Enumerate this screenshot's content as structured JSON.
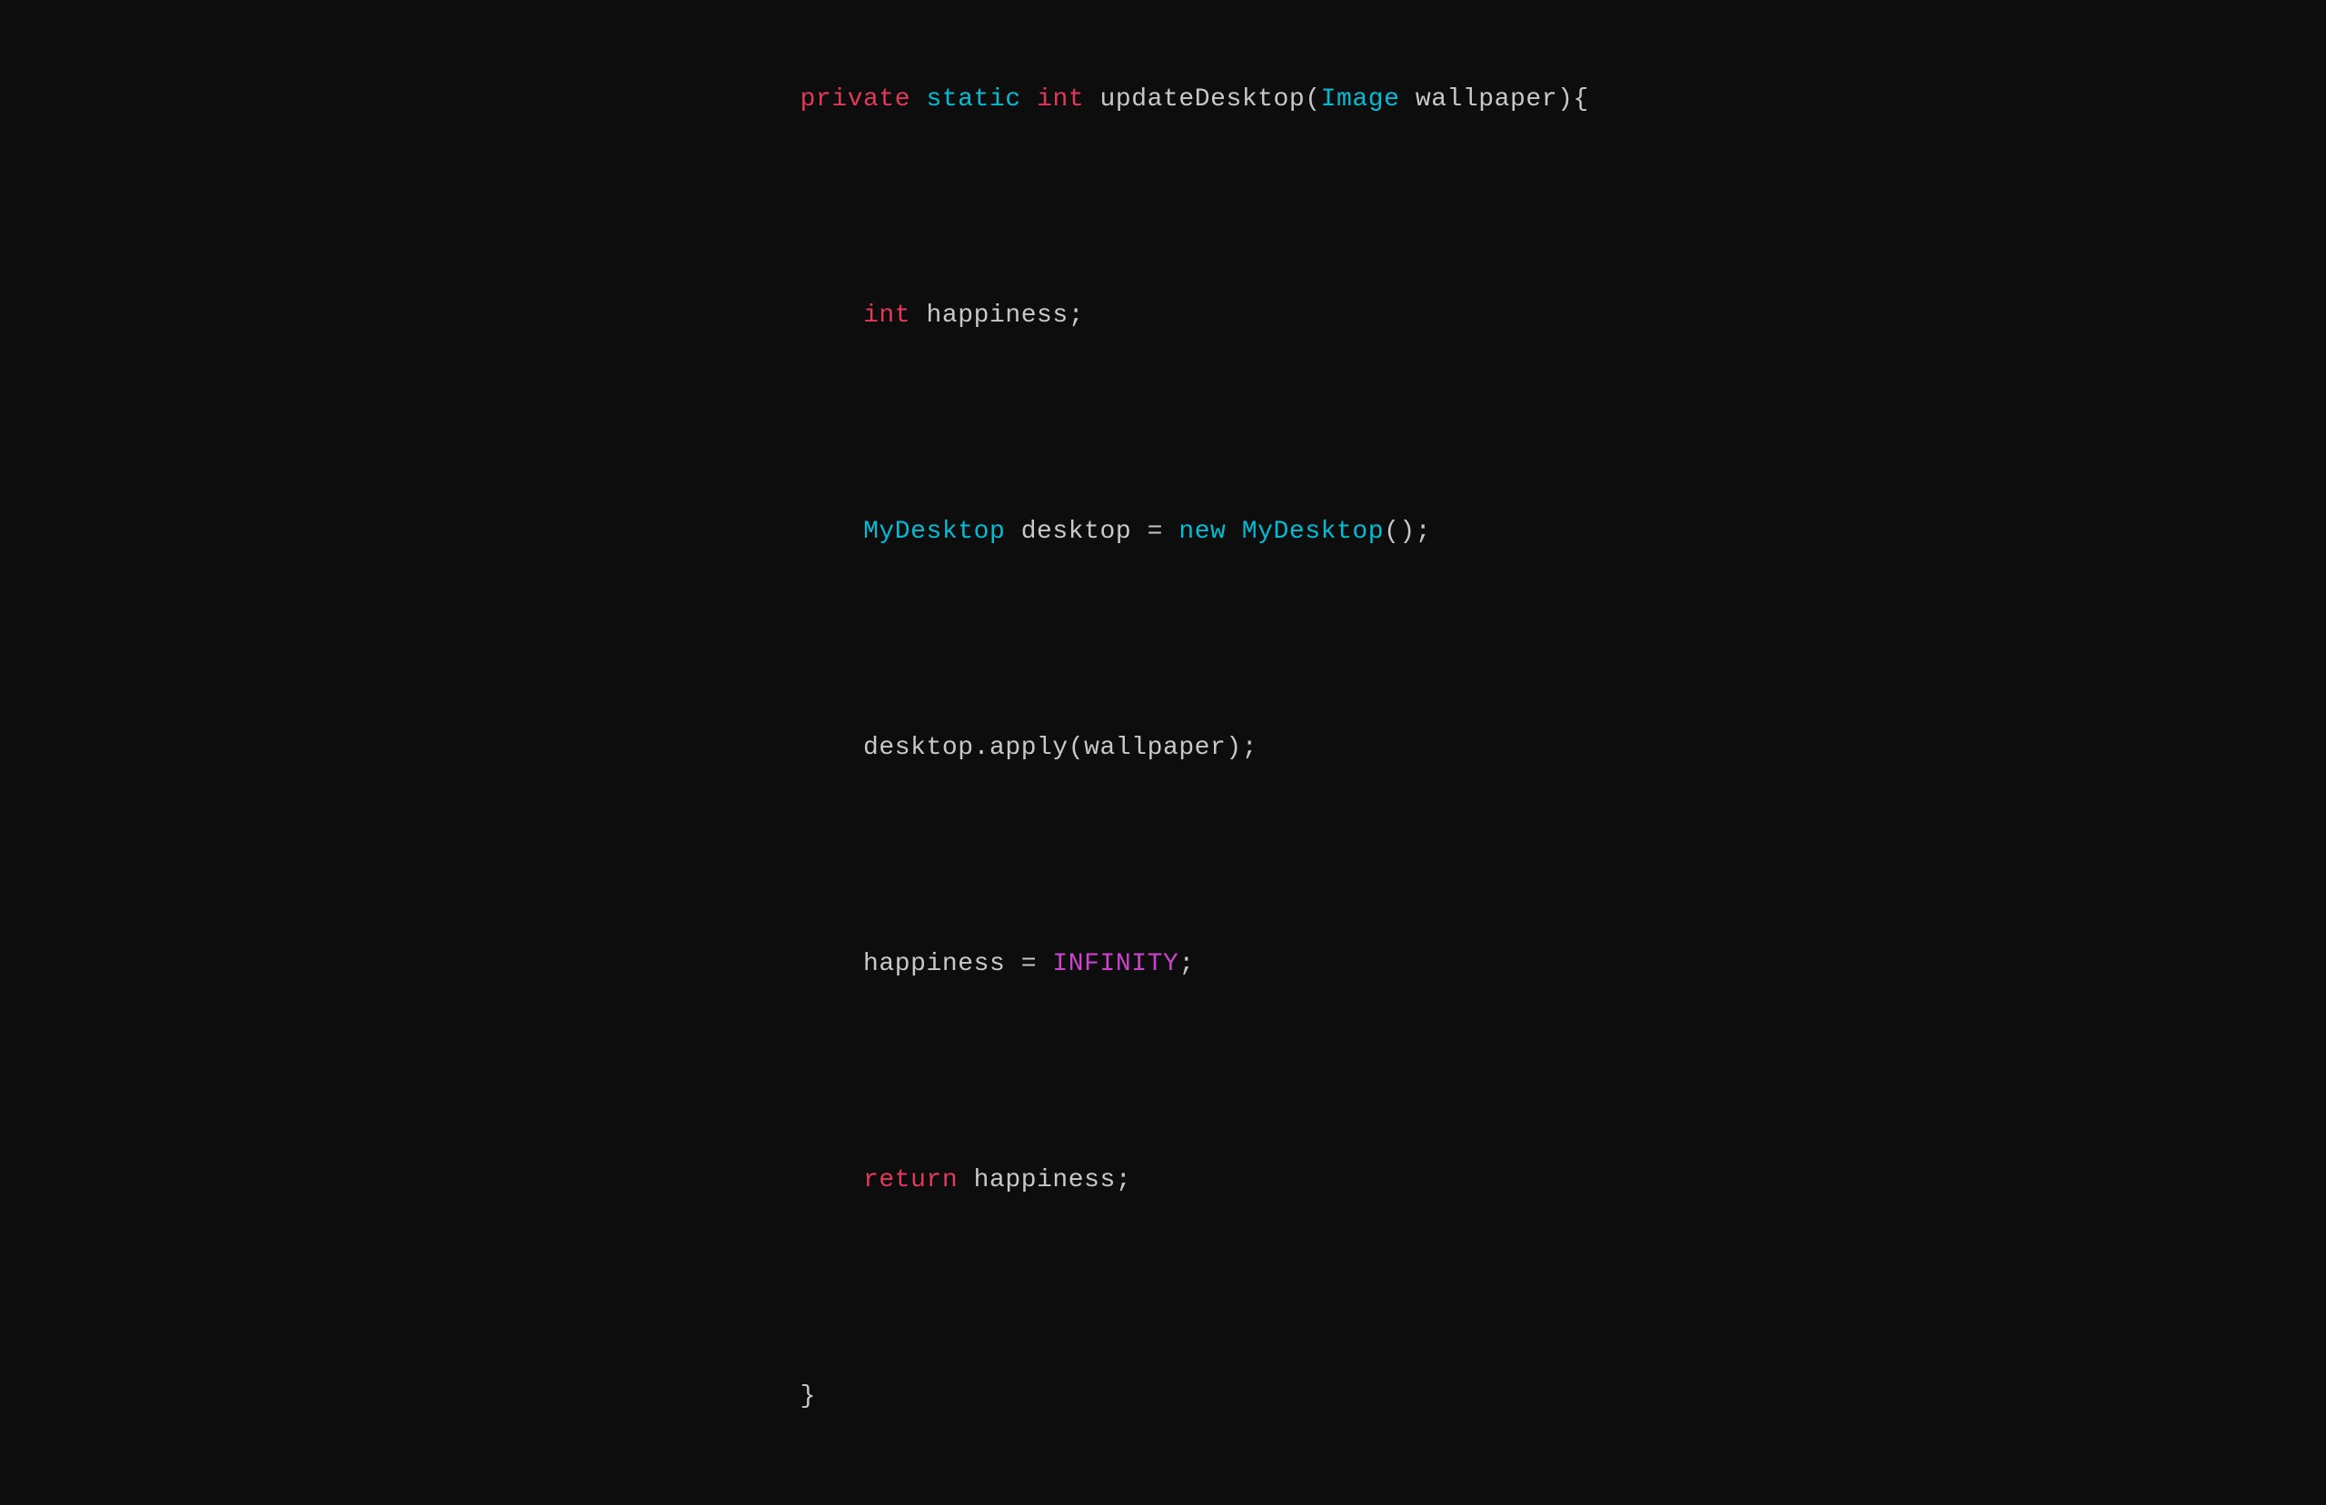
{
  "code": {
    "line1": {
      "parts": [
        {
          "text": "private",
          "class": "keyword-private"
        },
        {
          "text": " ",
          "class": "default"
        },
        {
          "text": "static",
          "class": "keyword-static"
        },
        {
          "text": " ",
          "class": "default"
        },
        {
          "text": "int",
          "class": "keyword-int"
        },
        {
          "text": " updateDesktop(",
          "class": "default"
        },
        {
          "text": "Image",
          "class": "type-image"
        },
        {
          "text": " wallpaper){",
          "class": "default"
        }
      ]
    },
    "line2": {
      "indent": "    ",
      "parts": [
        {
          "text": "int",
          "class": "keyword-int"
        },
        {
          "text": " happiness;",
          "class": "default"
        }
      ]
    },
    "line3": {
      "indent": "    ",
      "parts": [
        {
          "text": "MyDesktop",
          "class": "type-mydesktop"
        },
        {
          "text": " desktop = ",
          "class": "default"
        },
        {
          "text": "new",
          "class": "keyword-new"
        },
        {
          "text": " ",
          "class": "default"
        },
        {
          "text": "MyDesktop",
          "class": "type-mydesktop"
        },
        {
          "text": "();",
          "class": "default"
        }
      ]
    },
    "line4": {
      "indent": "    ",
      "parts": [
        {
          "text": "desktop.apply(wallpaper);",
          "class": "default"
        }
      ]
    },
    "line5": {
      "indent": "    ",
      "parts": [
        {
          "text": "happiness = ",
          "class": "default"
        },
        {
          "text": "INFINITY",
          "class": "constant"
        },
        {
          "text": ";",
          "class": "default"
        }
      ]
    },
    "line6": {
      "indent": "    ",
      "parts": [
        {
          "text": "return",
          "class": "keyword-return"
        },
        {
          "text": " happiness;",
          "class": "default"
        }
      ]
    },
    "line7": {
      "parts": [
        {
          "text": "}",
          "class": "brace"
        }
      ]
    }
  }
}
